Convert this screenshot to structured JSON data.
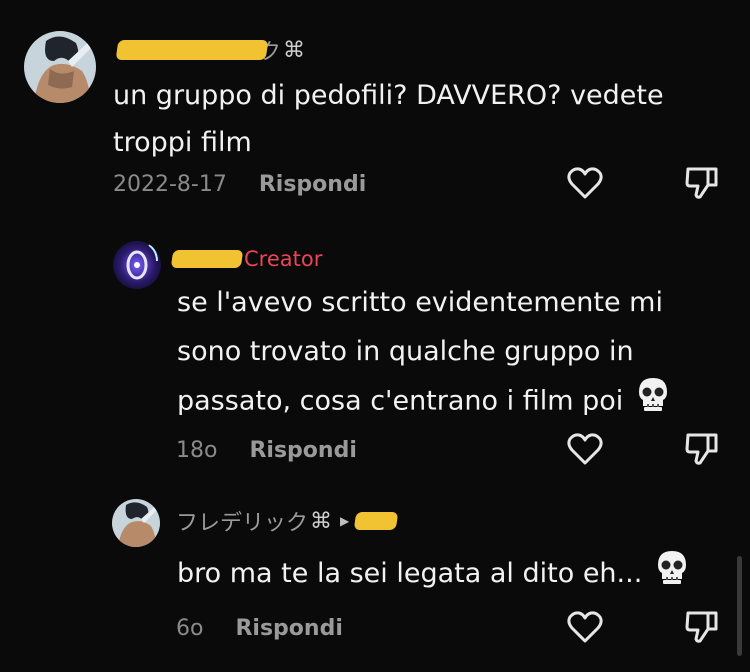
{
  "comments": [
    {
      "username_visible": "ク",
      "text_line1": "un gruppo di pedofili? DAVVERO? vedete",
      "text_line2": "troppi film",
      "date": "2022-8-17",
      "reply_label": "Rispondi"
    },
    {
      "creator_label": "Creator",
      "text_line1": "se l'avevo scritto evidentemente mi",
      "text_line2": "sono trovato in qualche gruppo in",
      "text_line3": "passato, cosa c'entrano i film poi",
      "date": "18o",
      "reply_label": "Rispondi"
    },
    {
      "username": "フレデリック",
      "text_line1": "bro ma te la sei legata al dito eh...",
      "date": "6o",
      "reply_label": "Rispondi"
    }
  ],
  "icons": {
    "like": "heart-outline-icon",
    "dislike": "thumbs-down-outline-icon",
    "emoji": "skull-emoji",
    "knot": "celtic-knot-symbol"
  },
  "colors": {
    "background": "#0a0a0a",
    "creator": "#e8455a",
    "redaction": "#f1c232"
  }
}
